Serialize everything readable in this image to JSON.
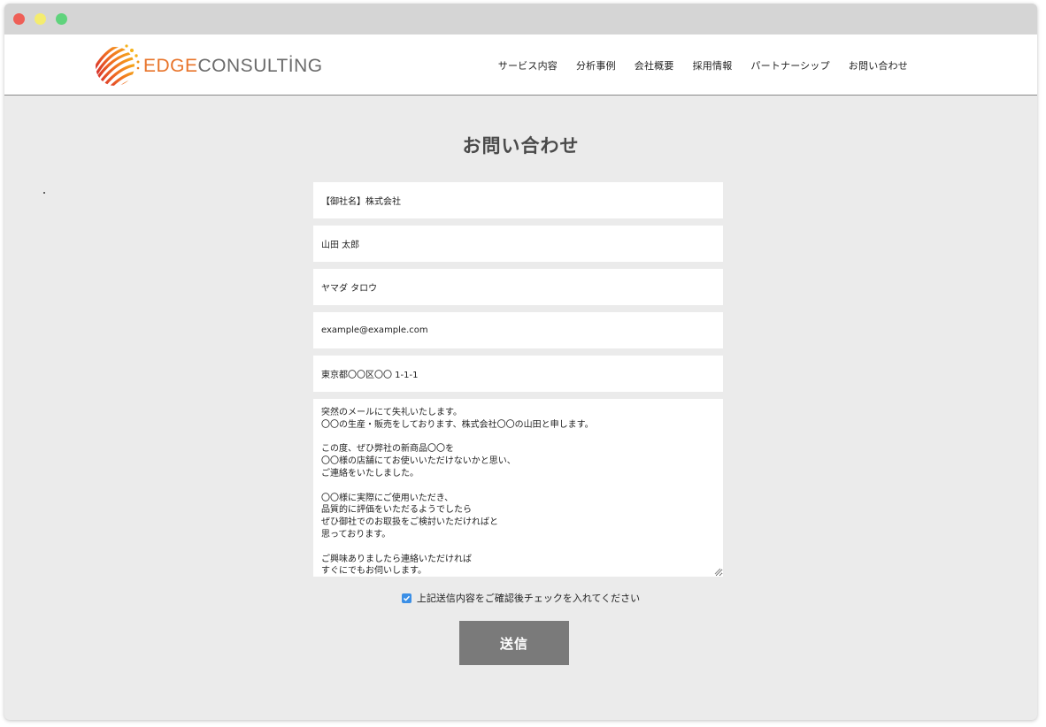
{
  "brand": {
    "name_part1": "EDGE",
    "name_part2": "CONSULTİNG",
    "accent_color": "#e8742a",
    "logo_icon": "striped-sphere-icon"
  },
  "nav": {
    "items": [
      {
        "label": "サービス内容"
      },
      {
        "label": "分析事例"
      },
      {
        "label": "会社概要"
      },
      {
        "label": "採用情報"
      },
      {
        "label": "パートナーシップ"
      },
      {
        "label": "お問い合わせ"
      }
    ]
  },
  "page": {
    "title": "お問い合わせ"
  },
  "form": {
    "company": "【御社名】株式会社",
    "name": "山田 太郎",
    "kana": "ヤマダ タロウ",
    "email": "example@example.com",
    "address": "東京都〇〇区〇〇 1-1-1",
    "message_lines": [
      "突然のメールにて失礼いたします。",
      "〇〇の生産・販売をしております、株式会社〇〇の山田と申します。",
      "",
      "この度、ぜひ弊社の新商品〇〇を",
      "〇〇様の店舗にてお使いいただけないかと思い、",
      "ご連絡をいたしました。",
      "",
      "〇〇様に実際にご使用いただき、",
      "品質的に評価をいただるようでしたら",
      "ぜひ御社でのお取扱をご検討いただければと",
      "思っております。",
      "",
      "ご興味ありましたら連絡いただければ",
      "すぐにでもお伺いします。"
    ],
    "consent_label": "上記送信内容をご確認後チェックを入れてください",
    "consent_checked": true,
    "submit_label": "送信"
  }
}
